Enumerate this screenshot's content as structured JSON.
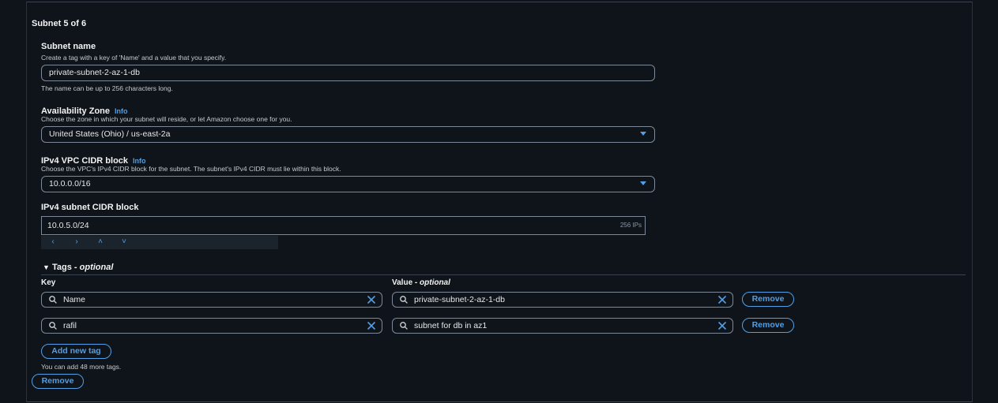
{
  "subnet": {
    "heading": "Subnet 5 of 6",
    "name": {
      "label": "Subnet name",
      "description": "Create a tag with a key of 'Name' and a value that you specify.",
      "value": "private-subnet-2-az-1-db",
      "hint": "The name can be up to 256 characters long."
    },
    "az": {
      "label": "Availability Zone",
      "info": "Info",
      "description": "Choose the zone in which your subnet will reside, or let Amazon choose one for you.",
      "value": "United States (Ohio) / us-east-2a"
    },
    "vpc_cidr": {
      "label": "IPv4 VPC CIDR block",
      "info": "Info",
      "description": "Choose the VPC's IPv4 CIDR block for the subnet. The subnet's IPv4 CIDR must lie within this block.",
      "value": "10.0.0.0/16"
    },
    "subnet_cidr": {
      "label": "IPv4 subnet CIDR block",
      "value": "10.0.5.0/24",
      "ips": "256 IPs",
      "stepper": [
        "‹",
        "›",
        "˄",
        "˅"
      ]
    },
    "tags": {
      "toggle": "▼",
      "title": "Tags - ",
      "title_optional": "optional",
      "key_header": "Key",
      "value_header": "Value - ",
      "value_header_optional": "optional",
      "rows": [
        {
          "key": "Name",
          "value": "private-subnet-2-az-1-db",
          "remove": "Remove"
        },
        {
          "key": "rafil",
          "value": "subnet for db in az1",
          "remove": "Remove"
        }
      ],
      "add_button": "Add new tag",
      "remaining_hint": "You can add 48 more tags."
    },
    "remove_subnet_button": "Remove"
  },
  "colors": {
    "background": "#0f141a",
    "accent": "#539fe5",
    "border": "#7d8998"
  }
}
